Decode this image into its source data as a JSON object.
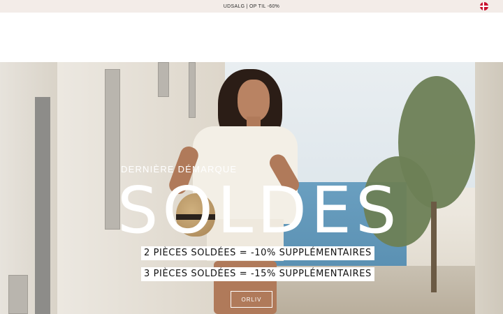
{
  "announcement": {
    "text": "UDSALG | OP TIL -60%",
    "flag_icon": "denmark-flag-icon"
  },
  "hero": {
    "eyebrow": "DERNIÈRE DÉMARQUE",
    "headline": "SOLDES",
    "promo_1": "2 PIÈCES SOLDÉES = -10% SUPPLÉMENTAIRES",
    "promo_2": "3 PIÈCES SOLDÉES = -15% SUPPLÉMENTAIRES",
    "cta_label": "ORLIV"
  },
  "colors": {
    "announcement_bg": "#f3ece8",
    "text_dark": "#2a2a2a",
    "white": "#ffffff"
  }
}
